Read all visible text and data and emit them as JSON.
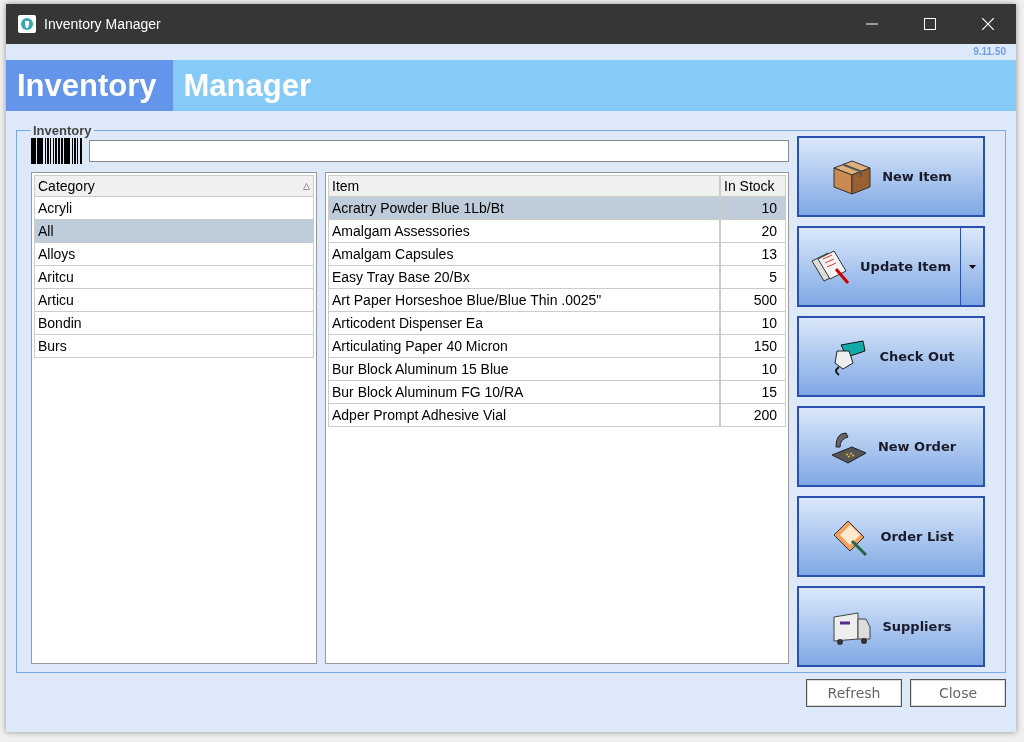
{
  "window": {
    "title": "Inventory Manager"
  },
  "version": "9.11.50",
  "banner": {
    "part_1": "Inventory",
    "part_2": "Manager"
  },
  "group": {
    "title": "Inventory"
  },
  "categories": {
    "column": "Category",
    "sorted": true,
    "rows": [
      {
        "name": "Acryli",
        "selected": false
      },
      {
        "name": "All",
        "selected": true
      },
      {
        "name": "Alloys",
        "selected": false
      },
      {
        "name": "Aritcu",
        "selected": false
      },
      {
        "name": "Articu",
        "selected": false
      },
      {
        "name": "Bondin",
        "selected": false
      },
      {
        "name": "Burs",
        "selected": false
      }
    ]
  },
  "items": {
    "columns": [
      "Item",
      "In Stock"
    ],
    "rows": [
      {
        "item": "Acratry Powder Blue 1Lb/Bt",
        "stock": "10",
        "selected": true
      },
      {
        "item": "Amalgam Assessories",
        "stock": "20",
        "selected": false
      },
      {
        "item": "Amalgam Capsules",
        "stock": "13",
        "selected": false
      },
      {
        "item": "Easy Tray Base 20/Bx",
        "stock": "5",
        "selected": false
      },
      {
        "item": "Art Paper Horseshoe Blue/Blue Thin .0025\"",
        "stock": "500",
        "selected": false
      },
      {
        "item": "Articodent Dispenser Ea",
        "stock": "10",
        "selected": false
      },
      {
        "item": "Articulating Paper 40 Micron",
        "stock": "150",
        "selected": false
      },
      {
        "item": "Bur Block Aluminum 15 Blue",
        "stock": "10",
        "selected": false
      },
      {
        "item": "Bur Block Aluminum FG 10/RA",
        "stock": "15",
        "selected": false
      },
      {
        "item": "Adper Prompt Adhesive Vial",
        "stock": "200",
        "selected": false
      }
    ]
  },
  "actions": [
    {
      "label": "New Item",
      "kind": "box",
      "has_menu": false
    },
    {
      "label": "Update Item",
      "kind": "papers",
      "has_menu": true
    },
    {
      "label": "Check Out",
      "kind": "scanner",
      "has_menu": false
    },
    {
      "label": "New Order",
      "kind": "phone",
      "has_menu": false
    },
    {
      "label": "Order List",
      "kind": "notepad",
      "has_menu": false
    },
    {
      "label": "Suppliers",
      "kind": "truck",
      "has_menu": false
    }
  ],
  "footer_buttons": [
    "Refresh",
    "Close"
  ]
}
